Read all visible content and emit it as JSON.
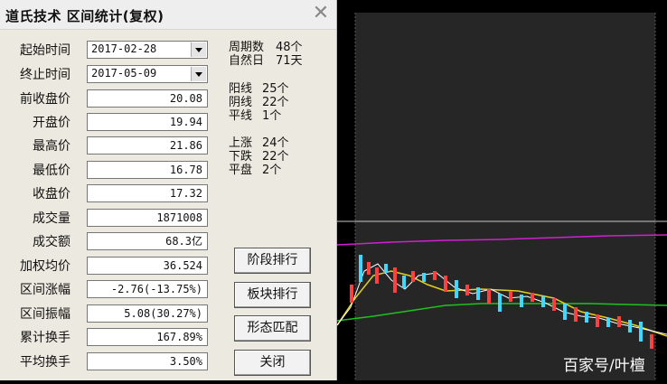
{
  "dialog": {
    "title": "道氏技术 区间统计(复权)",
    "close_symbol": "✕",
    "start_label": "起始时间",
    "start_value": "2017-02-28",
    "end_label": "终止时间",
    "end_value": "2017-05-09",
    "fields": [
      {
        "label": "前收盘价",
        "value": "20.08"
      },
      {
        "label": "开盘价",
        "value": "19.94"
      },
      {
        "label": "最高价",
        "value": "21.86"
      },
      {
        "label": "最低价",
        "value": "16.78"
      },
      {
        "label": "收盘价",
        "value": "17.32"
      },
      {
        "label": "成交量",
        "value": "1871008"
      },
      {
        "label": "成交额",
        "value": "68.3亿"
      },
      {
        "label": "加权均价",
        "value": "36.524"
      },
      {
        "label": "区间涨幅",
        "value": "-2.76(-13.75%)"
      },
      {
        "label": "区间振幅",
        "value": "5.08(30.27%)"
      },
      {
        "label": "累计换手",
        "value": "167.89%"
      },
      {
        "label": "平均换手",
        "value": "3.50%"
      }
    ],
    "stats": [
      {
        "label": "周期数",
        "value": "48个"
      },
      {
        "label": "自然日",
        "value": "71天"
      },
      {
        "label": "阳线",
        "value": "25个"
      },
      {
        "label": "阴线",
        "value": "22个"
      },
      {
        "label": "平线",
        "value": "1个"
      },
      {
        "label": "上涨",
        "value": "24个"
      },
      {
        "label": "下跌",
        "value": "22个"
      },
      {
        "label": "平盘",
        "value": "2个"
      }
    ],
    "buttons": [
      "阶段排行",
      "板块排行",
      "形态匹配",
      "关闭"
    ]
  },
  "chart": {
    "colors": {
      "panel": "#262626",
      "ma_long": "#d020d0",
      "ma_green": "#20c020",
      "ma_yellow": "#e0d020",
      "ma_white": "#ffffff",
      "up": "#ff4040",
      "down": "#40d8ff",
      "crosshair": "#c8c8c8"
    }
  },
  "watermark": "百家号/叶檀"
}
